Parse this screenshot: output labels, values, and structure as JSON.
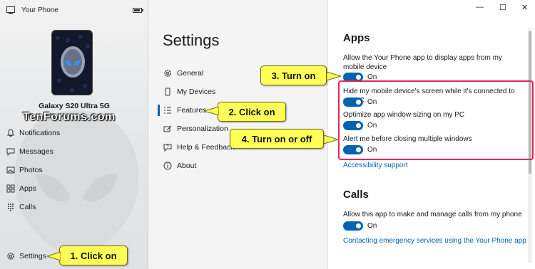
{
  "app": {
    "title": "Your Phone"
  },
  "device": {
    "name": "Galaxy S20 Ultra 5G"
  },
  "watermark": "TenForums.com",
  "left_nav": [
    {
      "label": "Notifications",
      "icon": "bell-icon"
    },
    {
      "label": "Messages",
      "icon": "chat-icon"
    },
    {
      "label": "Photos",
      "icon": "photo-icon"
    },
    {
      "label": "Apps",
      "icon": "apps-grid-icon"
    },
    {
      "label": "Calls",
      "icon": "dialpad-icon"
    }
  ],
  "settings_nav_item": {
    "label": "Settings",
    "icon": "gear-icon"
  },
  "settings": {
    "title": "Settings",
    "items": [
      {
        "label": "General",
        "icon": "gear-icon"
      },
      {
        "label": "My Devices",
        "icon": "phone-icon"
      },
      {
        "label": "Features",
        "icon": "list-icon",
        "selected": true
      },
      {
        "label": "Personalization",
        "icon": "brush-icon"
      },
      {
        "label": "Help & Feedback",
        "icon": "help-icon"
      },
      {
        "label": "About",
        "icon": "info-icon"
      }
    ]
  },
  "window_controls": {
    "minimize": "—",
    "maximize": "☐",
    "close": "✕"
  },
  "apps_section": {
    "heading": "Apps",
    "options": [
      {
        "text": "Allow the Your Phone app to display apps from my mobile device",
        "state": "On"
      },
      {
        "text": "Hide my mobile device's screen while it's connected to my PC",
        "state": "On"
      },
      {
        "text": "Optimize app window sizing on my PC",
        "state": "On"
      },
      {
        "text": "Alert me before closing multiple windows",
        "state": "On"
      }
    ],
    "link": "Accessibility support"
  },
  "calls_section": {
    "heading": "Calls",
    "options": [
      {
        "text": "Allow this app to make and manage calls from my phone",
        "state": "On"
      }
    ],
    "link": "Contacting emergency services using the Your Phone app"
  },
  "callouts": {
    "c1": "1. Click on",
    "c2": "2. Click on",
    "c3": "3. Turn on",
    "c4": "4. Turn on or off"
  },
  "colors": {
    "accent": "#0063b1",
    "callout": "#ffff57",
    "highlight": "#e8245c"
  }
}
